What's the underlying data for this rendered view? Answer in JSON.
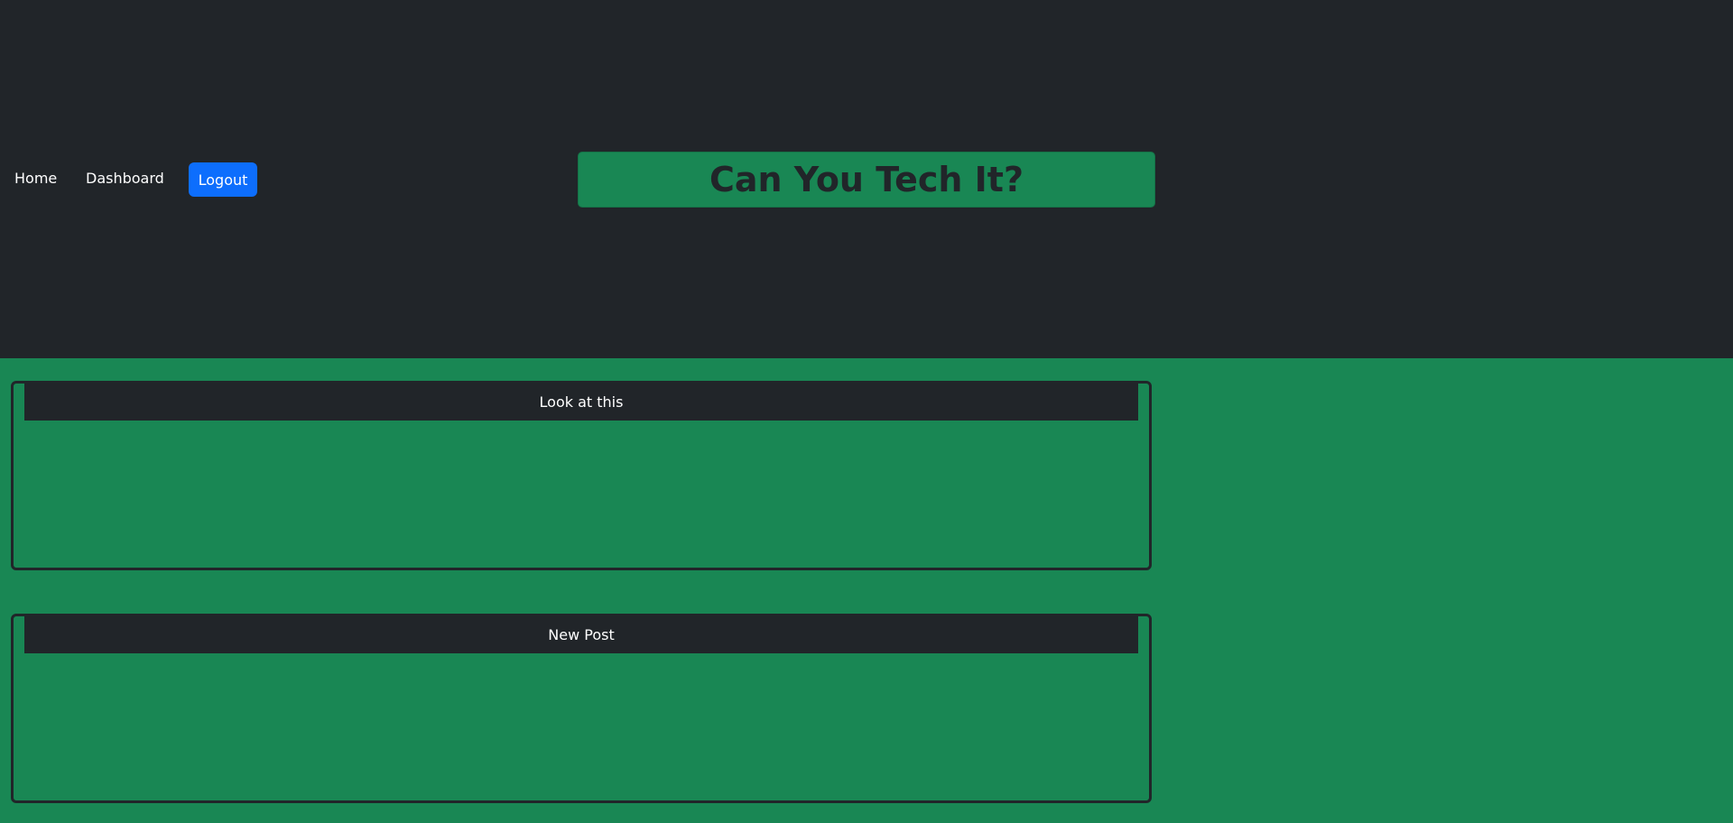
{
  "nav": {
    "home_label": "Home",
    "dashboard_label": "Dashboard",
    "logout_label": "Logout"
  },
  "header": {
    "title": "Can You Tech It?"
  },
  "posts": [
    {
      "title": "Look at this"
    },
    {
      "title": "New Post"
    }
  ],
  "colors": {
    "header_bg": "#212529",
    "page_bg": "#198754",
    "logout_btn": "#0d6efd"
  }
}
